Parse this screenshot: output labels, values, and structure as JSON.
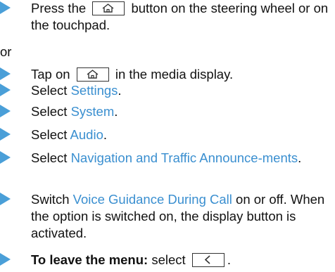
{
  "steps": [
    {
      "prefix": "Press the",
      "icon": "home-icon",
      "suffix": "button on the steering wheel or on the touchpad."
    },
    {
      "separator": "or"
    },
    {
      "prefix": "Tap on",
      "icon": "home-icon",
      "suffix": "in the media display."
    },
    {
      "prefix": "Select",
      "link": "Settings",
      "suffix": "."
    },
    {
      "prefix": "Select",
      "link": "System",
      "suffix": "."
    },
    {
      "prefix": "Select",
      "link": "Audio",
      "suffix": "."
    },
    {
      "prefix": "Select",
      "link": "Navigation and Traffic Announce-ments",
      "suffix": "."
    },
    {
      "prefix": "Switch",
      "link": "Voice Guidance During Call",
      "suffix": "on or off. When the option is switched on, the display button is activated."
    },
    {
      "bold": "To leave the menu:",
      "prefix": "select",
      "icon": "back-chevron-icon",
      "suffix": "."
    }
  ],
  "colors": {
    "marker": "#4a9fd8",
    "link": "#3a8fd0",
    "text": "#111111"
  }
}
